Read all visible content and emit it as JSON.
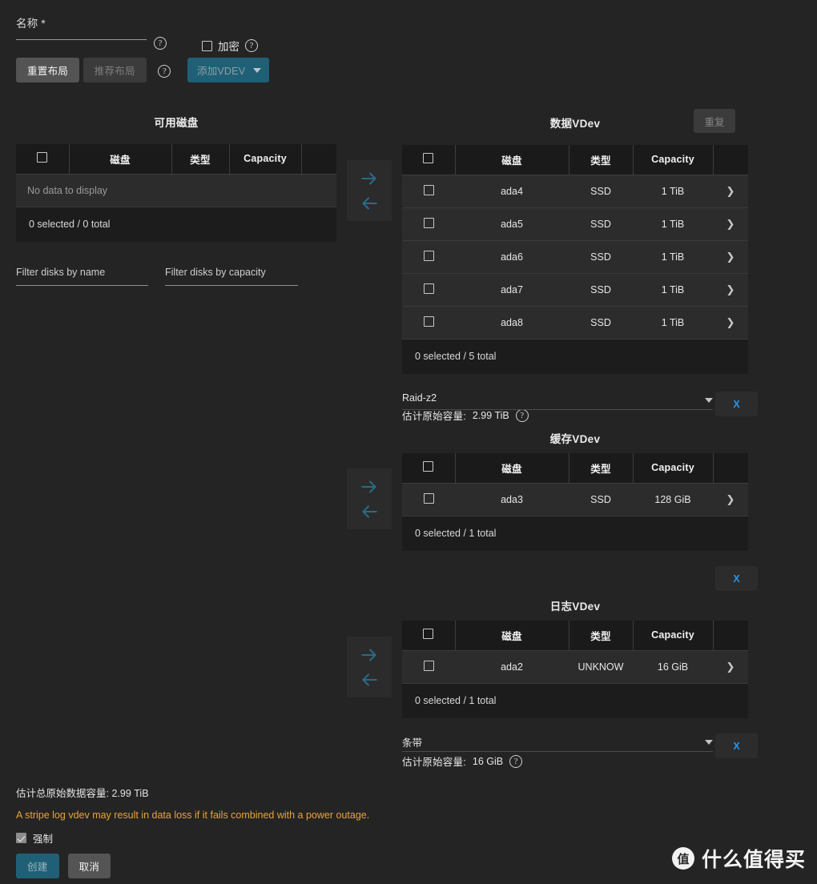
{
  "form": {
    "name_label": "名称 *",
    "name_value": "",
    "encrypt_label": "加密",
    "encrypt_checked": false,
    "help_glyph": "?"
  },
  "toolbar": {
    "reset_layout": "重置布局",
    "suggest_layout": "推荐布局",
    "add_vdev": "添加VDEV"
  },
  "available": {
    "title": "可用磁盘",
    "columns": [
      "磁盘",
      "类型",
      "Capacity"
    ],
    "empty_text": "No data to display",
    "footer": "0 selected / 0 total",
    "filter_name_placeholder": "Filter disks by name",
    "filter_capacity_placeholder": "Filter disks by capacity"
  },
  "data_vdev": {
    "title": "数据VDev",
    "repeat_label": "重复",
    "columns": [
      "磁盘",
      "类型",
      "Capacity"
    ],
    "rows": [
      {
        "disk": "ada4",
        "type": "SSD",
        "capacity": "1 TiB"
      },
      {
        "disk": "ada5",
        "type": "SSD",
        "capacity": "1 TiB"
      },
      {
        "disk": "ada6",
        "type": "SSD",
        "capacity": "1 TiB"
      },
      {
        "disk": "ada7",
        "type": "SSD",
        "capacity": "1 TiB"
      },
      {
        "disk": "ada8",
        "type": "SSD",
        "capacity": "1 TiB"
      }
    ],
    "footer": "0 selected / 5 total",
    "layout": "Raid-z2",
    "est_label": "估计原始容量:",
    "est_value": "2.99 TiB",
    "remove_label": "X"
  },
  "cache_vdev": {
    "title": "缓存VDev",
    "columns": [
      "磁盘",
      "类型",
      "Capacity"
    ],
    "rows": [
      {
        "disk": "ada3",
        "type": "SSD",
        "capacity": "128 GiB"
      }
    ],
    "footer": "0 selected / 1 total",
    "remove_label": "X"
  },
  "log_vdev": {
    "title": "日志VDev",
    "columns": [
      "磁盘",
      "类型",
      "Capacity"
    ],
    "rows": [
      {
        "disk": "ada2",
        "type": "UNKNOW",
        "capacity": "16 GiB"
      }
    ],
    "footer": "0 selected / 1 total",
    "layout": "条带",
    "est_label": "估计原始容量:",
    "est_value": "16 GiB",
    "remove_label": "X"
  },
  "summary": {
    "total_capacity": "估计总原始数据容量: 2.99 TiB",
    "warning": "A stripe log vdev may result in data loss if it fails combined with a power outage.",
    "force_label": "强制",
    "force_checked": true,
    "create_label": "创建",
    "cancel_label": "取消"
  },
  "watermark": {
    "badge": "值",
    "text": "什么值得买"
  },
  "colors": {
    "background": "#242424",
    "table_header": "#1a1a1a",
    "table_row": "#2c2c2c",
    "accent_teal": "#1f6076",
    "accent_blue": "#2196f3",
    "warning": "#e8a33d"
  }
}
